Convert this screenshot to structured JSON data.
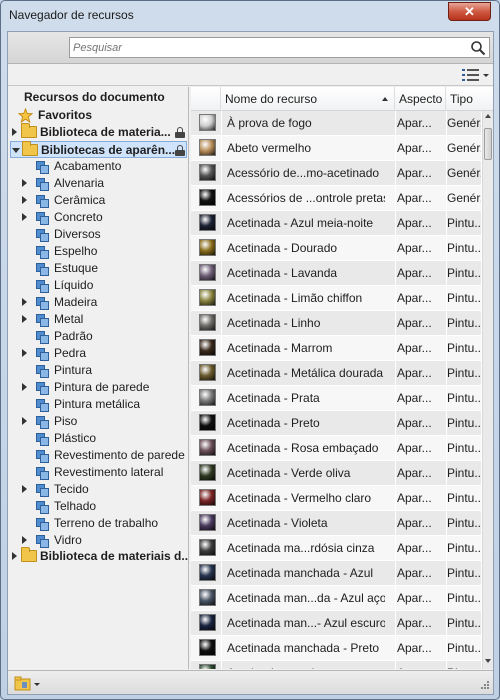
{
  "window": {
    "title": "Navegador de recursos",
    "close_glyph": "✕"
  },
  "search": {
    "placeholder": "Pesquisar",
    "icon": "search-icon"
  },
  "toolbar": {
    "view_icon": "list-view-icon"
  },
  "tree": {
    "heading": "Recursos do documento",
    "favorites": "Favoritos",
    "library1": "Biblioteca de materia...",
    "library2": "Bibliotecas de aparên...",
    "library3": "Biblioteca de materiais d...",
    "categories": [
      {
        "label": "Acabamento",
        "expandable": false
      },
      {
        "label": "Alvenaria",
        "expandable": true
      },
      {
        "label": "Cerâmica",
        "expandable": true
      },
      {
        "label": "Concreto",
        "expandable": true
      },
      {
        "label": "Diversos",
        "expandable": false
      },
      {
        "label": "Espelho",
        "expandable": false
      },
      {
        "label": "Estuque",
        "expandable": false
      },
      {
        "label": "Líquido",
        "expandable": false
      },
      {
        "label": "Madeira",
        "expandable": true
      },
      {
        "label": "Metal",
        "expandable": true
      },
      {
        "label": "Padrão",
        "expandable": false
      },
      {
        "label": "Pedra",
        "expandable": true
      },
      {
        "label": "Pintura",
        "expandable": false
      },
      {
        "label": "Pintura de parede",
        "expandable": true
      },
      {
        "label": "Pintura metálica",
        "expandable": false
      },
      {
        "label": "Piso",
        "expandable": true
      },
      {
        "label": "Plástico",
        "expandable": false
      },
      {
        "label": "Revestimento de parede",
        "expandable": false
      },
      {
        "label": "Revestimento lateral",
        "expandable": false
      },
      {
        "label": "Tecido",
        "expandable": true
      },
      {
        "label": "Telhado",
        "expandable": false
      },
      {
        "label": "Terreno de trabalho",
        "expandable": false
      },
      {
        "label": "Vidro",
        "expandable": true
      }
    ]
  },
  "table": {
    "headers": {
      "name": "Nome do recurso",
      "aspect": "Aspecto",
      "type": "Tipo"
    },
    "rows": [
      {
        "name": "À prova de fogo",
        "aspect": "Apar...",
        "type": "Genér...",
        "swatch": "#cfcfcf"
      },
      {
        "name": "Abeto vermelho",
        "aspect": "Apar...",
        "type": "Genér...",
        "swatch": "#b98e5a"
      },
      {
        "name": "Acessório de...mo-acetinado",
        "aspect": "Apar...",
        "type": "Genér...",
        "swatch": "#555555"
      },
      {
        "name": "Acessórios de ...ontrole pretas",
        "aspect": "Apar...",
        "type": "Genér...",
        "swatch": "#111111"
      },
      {
        "name": "Acetinada - Azul meia-noite",
        "aspect": "Apar...",
        "type": "Pintu...",
        "swatch": "#1c2233"
      },
      {
        "name": "Acetinada - Dourado",
        "aspect": "Apar...",
        "type": "Pintu...",
        "swatch": "#8a6d1c"
      },
      {
        "name": "Acetinada - Lavanda",
        "aspect": "Apar...",
        "type": "Pintu...",
        "swatch": "#6f5f78"
      },
      {
        "name": "Acetinada - Limão chiffon",
        "aspect": "Apar...",
        "type": "Pintu...",
        "swatch": "#8a8540"
      },
      {
        "name": "Acetinada - Linho",
        "aspect": "Apar...",
        "type": "Pintu...",
        "swatch": "#6e6c68"
      },
      {
        "name": "Acetinada - Marrom",
        "aspect": "Apar...",
        "type": "Pintu...",
        "swatch": "#3a2a1c"
      },
      {
        "name": "Acetinada - Metálica dourada",
        "aspect": "Apar...",
        "type": "Pintu...",
        "swatch": "#6a5a2c"
      },
      {
        "name": "Acetinada - Prata",
        "aspect": "Apar...",
        "type": "Pintu...",
        "swatch": "#7a7a7a"
      },
      {
        "name": "Acetinada - Preto",
        "aspect": "Apar...",
        "type": "Pintu...",
        "swatch": "#0e0e0e"
      },
      {
        "name": "Acetinada - Rosa embaçado",
        "aspect": "Apar...",
        "type": "Pintu...",
        "swatch": "#6b4f58"
      },
      {
        "name": "Acetinada - Verde oliva",
        "aspect": "Apar...",
        "type": "Pintu...",
        "swatch": "#2f3a22"
      },
      {
        "name": "Acetinada - Vermelho claro",
        "aspect": "Apar...",
        "type": "Pintu...",
        "swatch": "#7a2424"
      },
      {
        "name": "Acetinada - Violeta",
        "aspect": "Apar...",
        "type": "Pintu...",
        "swatch": "#4a3a5e"
      },
      {
        "name": "Acetinada ma...rdósia cinza",
        "aspect": "Apar...",
        "type": "Pintu...",
        "swatch": "#3c3c3c"
      },
      {
        "name": "Acetinada manchada - Azul",
        "aspect": "Apar...",
        "type": "Pintu...",
        "swatch": "#26344f"
      },
      {
        "name": "Acetinada man...da - Azul aço",
        "aspect": "Apar...",
        "type": "Pintu...",
        "swatch": "#4a5566"
      },
      {
        "name": "Acetinada man...- Azul escuro",
        "aspect": "Apar...",
        "type": "Pintu...",
        "swatch": "#1a2440"
      },
      {
        "name": "Acetinada manchada - Preto",
        "aspect": "Apar...",
        "type": "Pintu...",
        "swatch": "#101010"
      },
      {
        "name": "Acetinada - ...ada",
        "aspect": "Apar...",
        "type": "Pintu...",
        "swatch": "#2d4a30"
      }
    ]
  },
  "footer": {
    "library_button_icon": "library-icon"
  }
}
